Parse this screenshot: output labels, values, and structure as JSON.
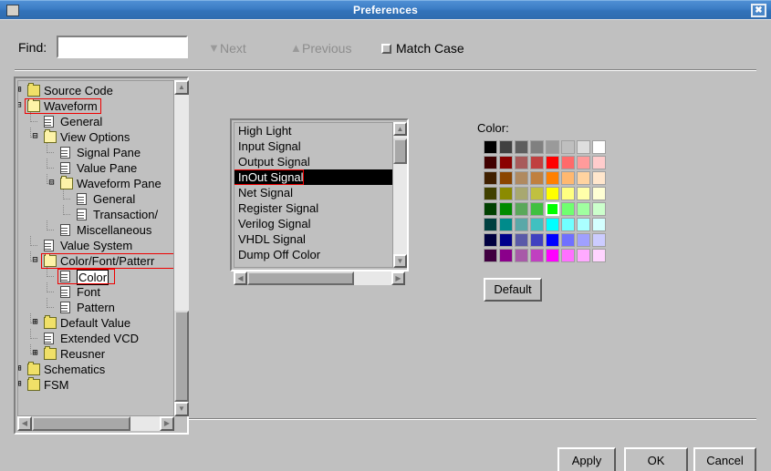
{
  "window": {
    "title": "Preferences",
    "sysmenu_icon": "window-menu-icon",
    "close_icon": "✖"
  },
  "find_bar": {
    "label": "Find:",
    "input_value": "",
    "input_placeholder": "",
    "next_label": "Next",
    "next_icon": "▼",
    "previous_label": "Previous",
    "previous_icon": "▲",
    "match_case_label": "Match Case",
    "match_case_checked": false
  },
  "tree": {
    "nodes": [
      {
        "label": "Source Code",
        "depth": 0,
        "icon": "folder-closed-icon",
        "expander": "+",
        "selected": false,
        "highlight": false
      },
      {
        "label": "Waveform",
        "depth": 0,
        "icon": "folder-open-icon",
        "expander": "-",
        "selected": false,
        "highlight": true
      },
      {
        "label": "General",
        "depth": 1,
        "icon": "document-icon",
        "expander": "",
        "selected": false,
        "highlight": false
      },
      {
        "label": "View Options",
        "depth": 1,
        "icon": "folder-open-icon",
        "expander": "-",
        "selected": false,
        "highlight": false
      },
      {
        "label": "Signal Pane",
        "depth": 2,
        "icon": "document-icon",
        "expander": "",
        "selected": false,
        "highlight": false
      },
      {
        "label": "Value Pane",
        "depth": 2,
        "icon": "document-icon",
        "expander": "",
        "selected": false,
        "highlight": false
      },
      {
        "label": "Waveform Pane",
        "depth": 2,
        "icon": "folder-open-icon",
        "expander": "-",
        "selected": false,
        "highlight": false
      },
      {
        "label": "General",
        "depth": 3,
        "icon": "document-icon",
        "expander": "",
        "selected": false,
        "highlight": false
      },
      {
        "label": "Transaction/",
        "depth": 3,
        "icon": "document-icon",
        "expander": "",
        "selected": false,
        "highlight": false
      },
      {
        "label": "Miscellaneous",
        "depth": 2,
        "icon": "document-icon",
        "expander": "",
        "selected": false,
        "highlight": false
      },
      {
        "label": "Value System",
        "depth": 1,
        "icon": "document-icon",
        "expander": "",
        "selected": false,
        "highlight": false
      },
      {
        "label": "Color/Font/Patterr",
        "depth": 1,
        "icon": "folder-open-icon",
        "expander": "-",
        "selected": false,
        "highlight": true
      },
      {
        "label": "Color",
        "depth": 2,
        "icon": "document-icon",
        "expander": "",
        "selected": true,
        "highlight": true
      },
      {
        "label": "Font",
        "depth": 2,
        "icon": "document-icon",
        "expander": "",
        "selected": false,
        "highlight": false
      },
      {
        "label": "Pattern",
        "depth": 2,
        "icon": "document-icon",
        "expander": "",
        "selected": false,
        "highlight": false
      },
      {
        "label": "Default Value",
        "depth": 1,
        "icon": "folder-closed-icon",
        "expander": "+",
        "selected": false,
        "highlight": false
      },
      {
        "label": "Extended VCD",
        "depth": 1,
        "icon": "document-icon",
        "expander": "",
        "selected": false,
        "highlight": false
      },
      {
        "label": "Reusner",
        "depth": 1,
        "icon": "folder-closed-icon",
        "expander": "+",
        "selected": false,
        "highlight": false
      },
      {
        "label": "Schematics",
        "depth": 0,
        "icon": "folder-closed-icon",
        "expander": "+",
        "selected": false,
        "highlight": false
      },
      {
        "label": "FSM",
        "depth": 0,
        "icon": "folder-closed-icon",
        "expander": "+",
        "selected": false,
        "highlight": false
      }
    ]
  },
  "color_items": {
    "items": [
      {
        "label": "High Light",
        "selected": false,
        "highlight": false
      },
      {
        "label": "Input Signal",
        "selected": false,
        "highlight": false
      },
      {
        "label": "Output Signal",
        "selected": false,
        "highlight": false
      },
      {
        "label": "InOut Signal",
        "selected": true,
        "highlight": true
      },
      {
        "label": "Net Signal",
        "selected": false,
        "highlight": false
      },
      {
        "label": "Register Signal",
        "selected": false,
        "highlight": false
      },
      {
        "label": "Verilog Signal",
        "selected": false,
        "highlight": false
      },
      {
        "label": "VHDL Signal",
        "selected": false,
        "highlight": false
      },
      {
        "label": "Dump Off Color",
        "selected": false,
        "highlight": false
      }
    ]
  },
  "color_picker": {
    "label": "Color:",
    "selected_index": 36,
    "selected_hex": "#ffff00",
    "swatches": [
      "#000000",
      "#404040",
      "#5e5e5e",
      "#808080",
      "#9a9a9a",
      "#bfbfbf",
      "#dedede",
      "#ffffff",
      "#400000",
      "#8b0000",
      "#a85a5a",
      "#c04040",
      "#ff0000",
      "#ff6a6a",
      "#ff9b9b",
      "#ffcccc",
      "#402000",
      "#8b4500",
      "#b08a60",
      "#c08040",
      "#ff8000",
      "#ffb870",
      "#ffd3a0",
      "#ffe6cc",
      "#404000",
      "#8b8b00",
      "#a8a870",
      "#c0c040",
      "#ffff00",
      "#ffff80",
      "#ffffaa",
      "#ffffd4",
      "#004000",
      "#008b00",
      "#5aa85a",
      "#40c040",
      "#00ff00",
      "#70ff70",
      "#a0ffa0",
      "#ccffcc",
      "#004040",
      "#008b8b",
      "#5aa8a8",
      "#40c0c0",
      "#00ffff",
      "#70ffff",
      "#aaffff",
      "#d4ffff",
      "#000040",
      "#00008b",
      "#5a5aa8",
      "#4040c0",
      "#0000ff",
      "#7070ff",
      "#a0a0ff",
      "#ccccff",
      "#400040",
      "#8b008b",
      "#a85aa8",
      "#c040c0",
      "#ff00ff",
      "#ff70ff",
      "#ffaaff",
      "#ffd4ff"
    ]
  },
  "buttons": {
    "default": "Default",
    "apply": "Apply",
    "ok": "OK",
    "cancel": "Cancel"
  }
}
